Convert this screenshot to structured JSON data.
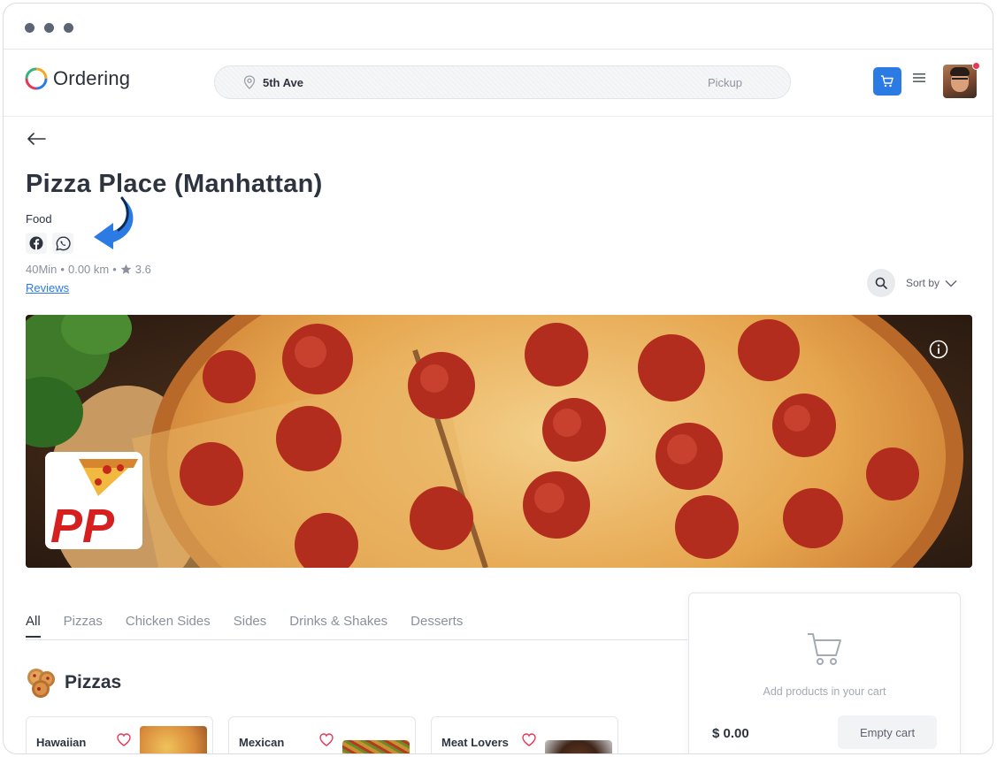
{
  "header": {
    "logo_text": "Ordering",
    "address": "5th Ave",
    "order_mode": "Pickup"
  },
  "store": {
    "name": "Pizza Place (Manhattan)",
    "category": "Food",
    "delivery_time": "40Min",
    "distance": "0.00 km",
    "rating": "3.6",
    "reviews_link": "Reviews",
    "logo_text": "PP"
  },
  "toolbar": {
    "sort_label": "Sort by"
  },
  "tabs": [
    "All",
    "Pizzas",
    "Chicken Sides",
    "Sides",
    "Drinks & Shakes",
    "Desserts"
  ],
  "section": {
    "title": "Pizzas"
  },
  "products": [
    {
      "name": "Hawaiian"
    },
    {
      "name": "Mexican"
    },
    {
      "name": "Meat Lovers"
    }
  ],
  "cart": {
    "empty_message": "Add products in your cart",
    "total": "$ 0.00",
    "empty_button": "Empty cart"
  },
  "colors": {
    "accent": "#2c7be5",
    "notification": "#e63757"
  }
}
